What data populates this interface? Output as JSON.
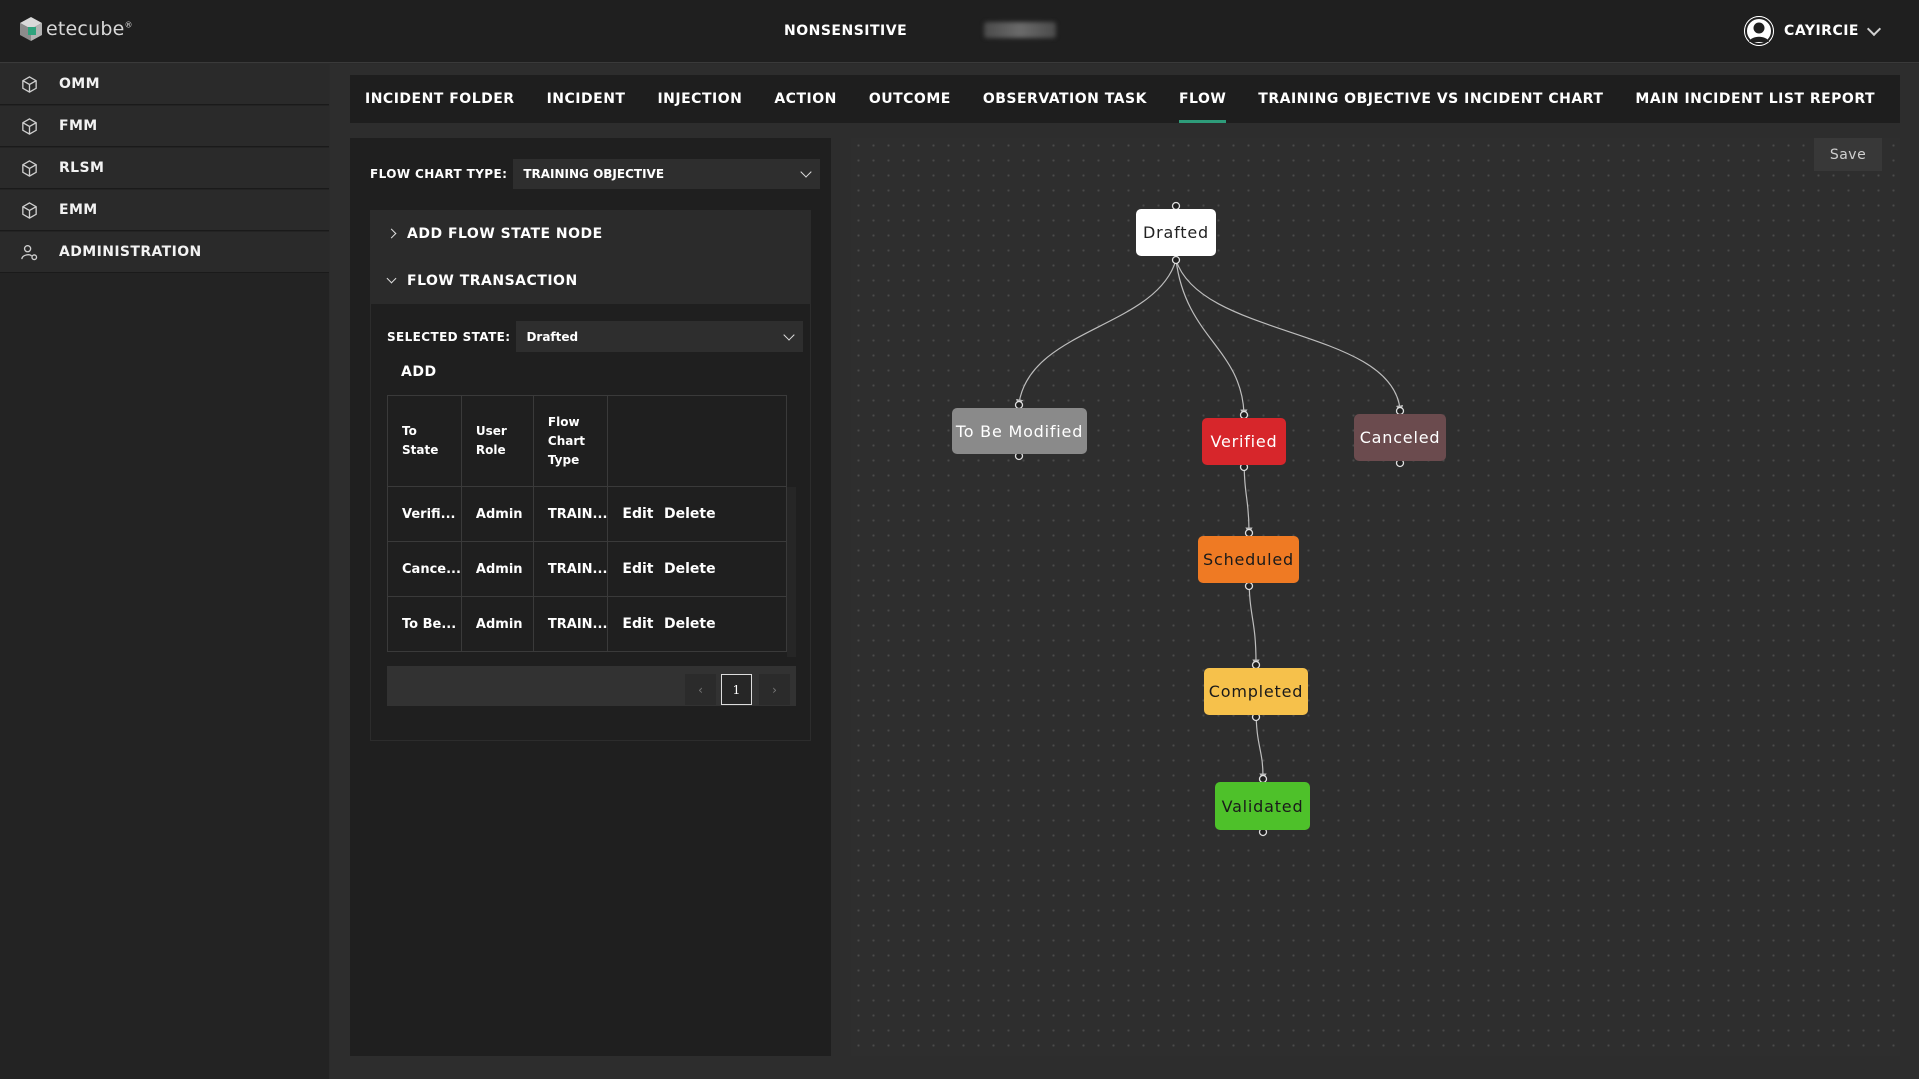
{
  "header": {
    "logo_text": "etecube",
    "logo_mark": "®",
    "classification": "NONSENSITIVE",
    "user_name": "CAYIRCIE"
  },
  "sidebar": {
    "items": [
      {
        "label": "OMM",
        "icon": "cube-icon"
      },
      {
        "label": "FMM",
        "icon": "cube-icon"
      },
      {
        "label": "RLSM",
        "icon": "cube-icon"
      },
      {
        "label": "EMM",
        "icon": "cube-icon"
      },
      {
        "label": "ADMINISTRATION",
        "icon": "user-gear-icon"
      }
    ]
  },
  "tabs": [
    {
      "label": "INCIDENT FOLDER"
    },
    {
      "label": "INCIDENT"
    },
    {
      "label": "INJECTION"
    },
    {
      "label": "ACTION"
    },
    {
      "label": "OUTCOME"
    },
    {
      "label": "OBSERVATION TASK"
    },
    {
      "label": "FLOW",
      "active": true
    },
    {
      "label": "TRAINING OBJECTIVE VS INCIDENT CHART"
    },
    {
      "label": "MAIN INCIDENT LIST REPORT"
    }
  ],
  "panel": {
    "flow_chart_type_label": "FLOW CHART TYPE:",
    "flow_chart_type_value": "TRAINING OBJECTIVE",
    "add_flow_state_node": "ADD FLOW STATE NODE",
    "flow_transaction": "FLOW TRANSACTION",
    "selected_state_label": "SELECTED STATE:",
    "selected_state_value": "Drafted",
    "add_label": "ADD",
    "table": {
      "headers": [
        "To State",
        "User Role",
        "Flow Chart Type",
        ""
      ],
      "rows": [
        {
          "to_state": "Verifi...",
          "role": "Admin",
          "type": "TRAIN...",
          "edit": "Edit",
          "delete": "Delete"
        },
        {
          "to_state": "Cance...",
          "role": "Admin",
          "type": "TRAIN...",
          "edit": "Edit",
          "delete": "Delete"
        },
        {
          "to_state": "To Be...",
          "role": "Admin",
          "type": "TRAIN...",
          "edit": "Edit",
          "delete": "Delete"
        }
      ]
    },
    "pagination": {
      "prev": "‹",
      "current": "1",
      "next": "›"
    }
  },
  "canvas": {
    "save_label": "Save",
    "nodes": {
      "drafted": {
        "label": "Drafted",
        "color": "#ffffff",
        "text_color": "#222222"
      },
      "to_be_modified": {
        "label": "To Be Modified",
        "color": "#8a8a8a",
        "text_color": "#ffffff"
      },
      "verified": {
        "label": "Verified",
        "color": "#d7262b",
        "text_color": "#ffffff"
      },
      "canceled": {
        "label": "Canceled",
        "color": "#6b4b4e",
        "text_color": "#ffffff"
      },
      "scheduled": {
        "label": "Scheduled",
        "color": "#ef7a23",
        "text_color": "#1a1a1a"
      },
      "completed": {
        "label": "Completed",
        "color": "#f6c14b",
        "text_color": "#1a1a1a"
      },
      "validated": {
        "label": "Validated",
        "color": "#4ec12a",
        "text_color": "#1a1a1a"
      }
    }
  }
}
